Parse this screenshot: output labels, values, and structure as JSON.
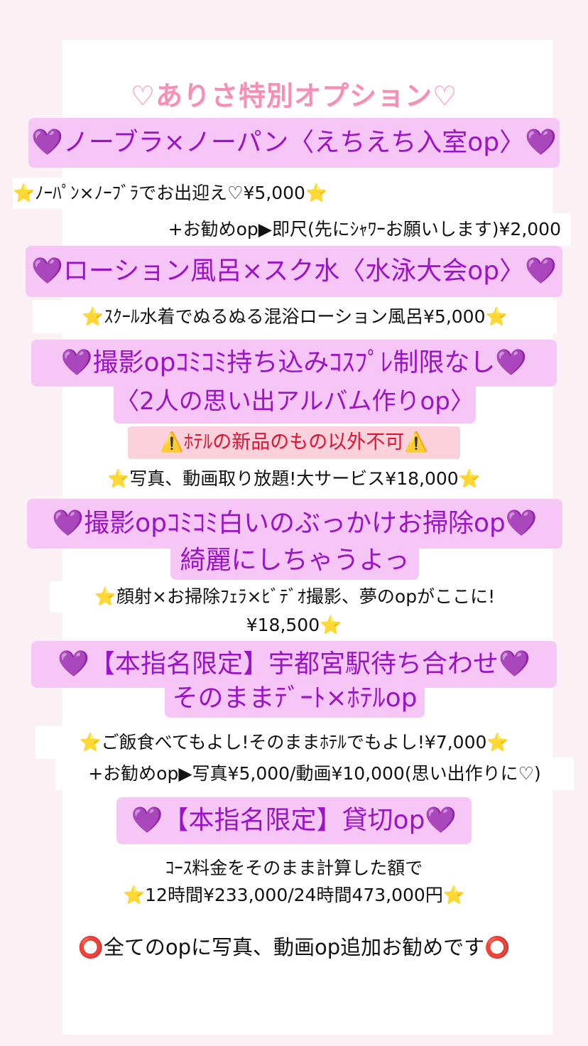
{
  "title": "♡ありさ特別オプション♡",
  "sec1": {
    "heading": "💜ノーブラ×ノーパン〈えちえち入室op〉💜",
    "line1": "⭐ﾉｰﾊﾟﾝ×ﾉｰﾌﾞﾗでお出迎え♡¥5,000⭐",
    "line2": "+お勧めop▶即尺(先にｼｬﾜｰお願いします)¥2,000"
  },
  "sec2": {
    "heading": "💜ローション風呂×スク水〈水泳大会op〉💜",
    "line1": "⭐ｽｸｰﾙ水着でぬるぬる混浴ローション風呂¥5,000⭐"
  },
  "sec3": {
    "heading1": "💜撮影opｺﾐｺﾐ持ち込みｺｽﾌﾟﾚ制限なし💜",
    "heading2": "〈2人の思い出アルバム作りop〉",
    "warning": "⚠️ﾎﾃﾙの新品のもの以外不可⚠️",
    "line1": "⭐写真、動画取り放題!大サービス¥18,000⭐"
  },
  "sec4": {
    "heading1": "💜撮影opｺﾐｺﾐ白いのぶっかけお掃除op💜",
    "heading2": "綺麗にしちゃうよっ",
    "line1": "⭐顔射×お掃除ﾌｪﾗ×ﾋﾞﾃﾞｵ撮影、夢のopがここに!",
    "line2": "¥18,500⭐"
  },
  "sec5": {
    "heading1": "💜【本指名限定】宇都宮駅待ち合わせ💜",
    "heading2": "そのままﾃﾞｰﾄ×ﾎﾃﾙop",
    "line1": "⭐ご飯食べてもよし!そのままﾎﾃﾙでもよし!¥7,000⭐",
    "line2": "+お勧めop▶写真¥5,000/動画¥10,000(思い出作りに♡)"
  },
  "sec6": {
    "heading": "💜【本指名限定】貸切op💜",
    "line1": "ｺｰｽ料金をそのまま計算した額で",
    "line2": "⭐12時間¥233,000/24時間473,000円⭐"
  },
  "footer": "⭕全てのopに写真、動画op追加お勧めです⭕",
  "colors": {
    "highlight_bg": "#f6c6f7",
    "highlight_text": "#9a13c9",
    "title_pink": "#f58fb5",
    "warning_bg": "#fbd2dc",
    "warning_text": "#e21232"
  }
}
